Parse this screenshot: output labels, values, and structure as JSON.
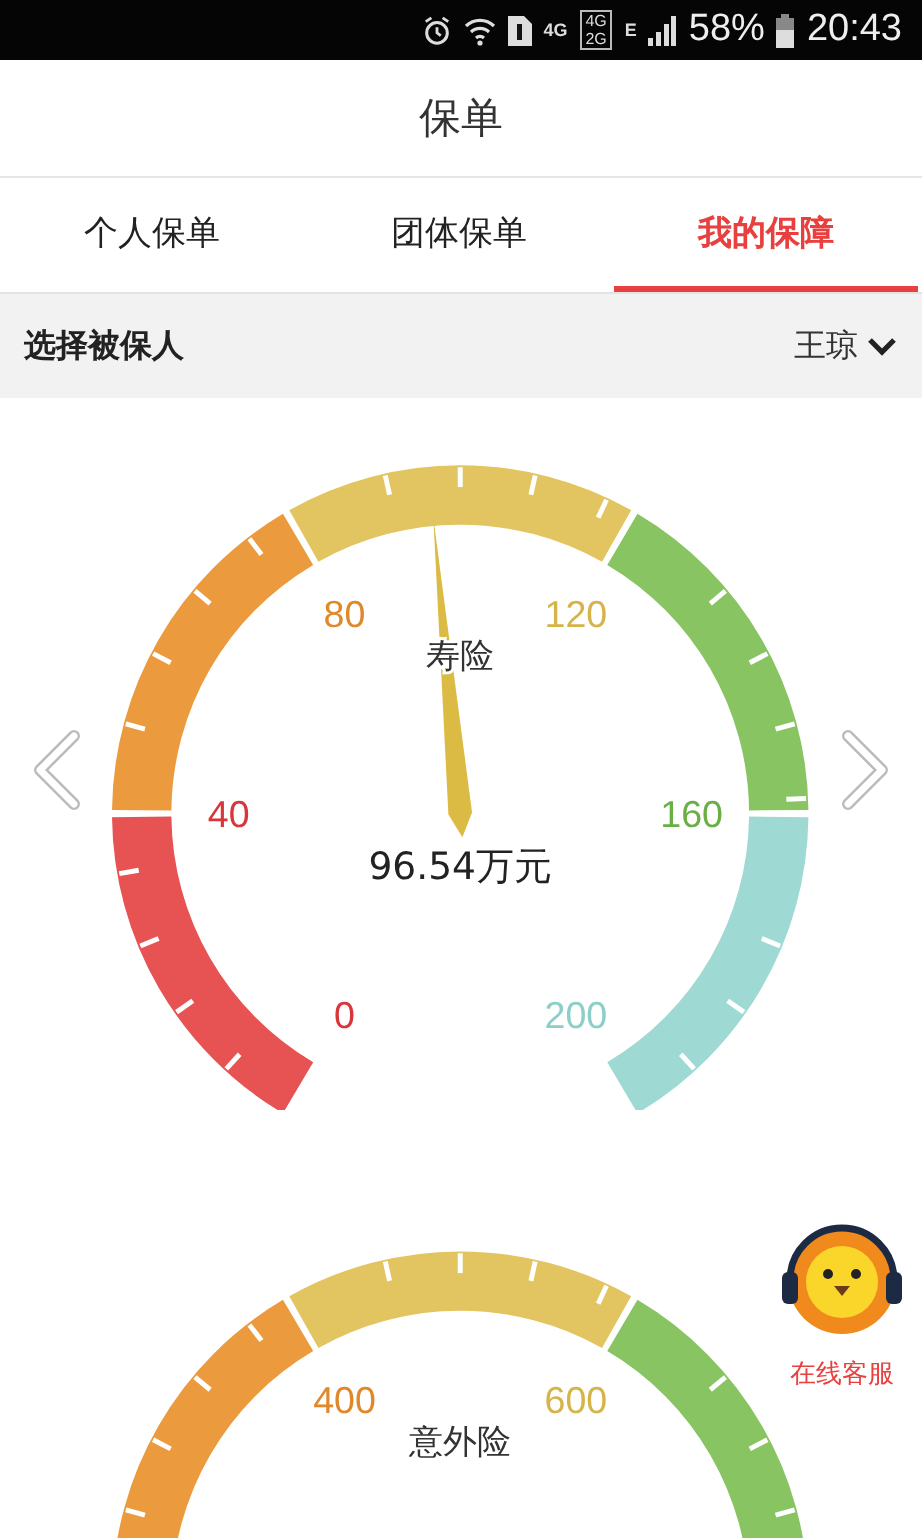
{
  "status_bar": {
    "network": "4G",
    "dual_top": "4G",
    "dual_bottom": "2G",
    "data": "E",
    "battery": "58%",
    "time": "20:43"
  },
  "title": "保单",
  "tabs": [
    {
      "label": "个人保单",
      "selected": false
    },
    {
      "label": "团体保单",
      "selected": false
    },
    {
      "label": "我的保障",
      "selected": true
    }
  ],
  "insured": {
    "label": "选择被保人",
    "value": "王琼"
  },
  "gauges": [
    {
      "title": "寿险",
      "value": "96.54万元",
      "level": 0.4827,
      "ticks": [
        "0",
        "40",
        "80",
        "120",
        "160",
        "200"
      ]
    },
    {
      "title": "意外险",
      "ticks": [
        "400",
        "600"
      ]
    }
  ],
  "support": {
    "label": "在线客服"
  }
}
